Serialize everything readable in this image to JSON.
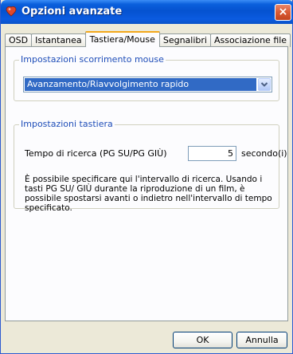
{
  "window": {
    "title": "Opzioni avanzate",
    "close_glyph": "×",
    "title_bar_color": "#0a5fdc"
  },
  "tabs": [
    {
      "label": "OSD",
      "active": false
    },
    {
      "label": "Istantanea",
      "active": false
    },
    {
      "label": "Tastiera/Mouse",
      "active": true
    },
    {
      "label": "Segnalibri",
      "active": false
    },
    {
      "label": "Associazione file",
      "active": false
    }
  ],
  "mouse_group": {
    "title": "Impostazioni scorrimento mouse",
    "select_value": "Avanzamento/Riavvolgimento rapido"
  },
  "keyboard_group": {
    "title": "Impostazioni tastiera",
    "seek_label": "Tempo di ricerca (PG SU/PG GIÙ)",
    "seek_value": "5",
    "seek_unit": "secondo(i)",
    "description": "È possibile specificare qui l'intervallo di ricerca. Usando i tasti PG SU/ GIÙ durante la riproduzione di un film, è possibile spostarsi avanti o indietro nell'intervallo di tempo specificato."
  },
  "buttons": {
    "ok": "OK",
    "cancel": "Annulla"
  },
  "colors": {
    "accent": "#316ac5",
    "group_title": "#1e4db8",
    "active_tab_highlight": "#f3a81c"
  },
  "icons": {
    "title": "app-icon",
    "close": "close-icon",
    "dropdown": "chevron-down-icon"
  }
}
